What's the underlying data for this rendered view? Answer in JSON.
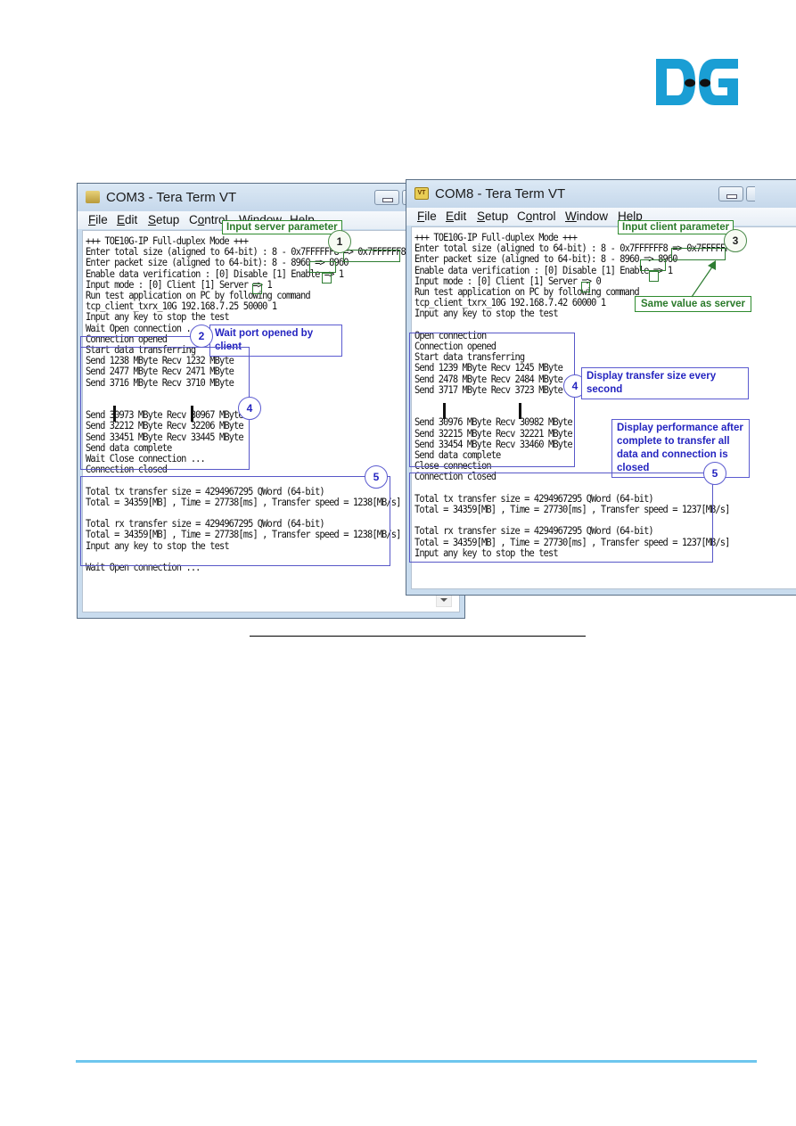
{
  "logo": {
    "text": "DG",
    "brand_color": "#1a9ed4"
  },
  "windows": [
    {
      "title": "COM3 - Tera Term VT",
      "menu": [
        "File",
        "Edit",
        "Setup",
        "Control",
        "Window",
        "Help"
      ],
      "menu_underline": [
        "F",
        "E",
        "S",
        "o",
        "W",
        "H"
      ],
      "lines": [
        "+++ TOE10G-IP Full-duplex Mode +++",
        "Enter total size (aligned to 64-bit) : 8 - 0x7FFFFFF8 => 0x7FFFFFF8",
        "Enter packet size (aligned to 64-bit): 8 - 8960 => 8960",
        "Enable data verification : [0] Disable [1] Enable => 1",
        "Input mode : [0] Client [1] Server => 1",
        "Run test application on PC by following command",
        "tcp_client_txrx_10G 192.168.7.25 50000 1",
        "Input any key to stop the test",
        "Wait Open connection ...",
        "Connection opened",
        "Start data transferring",
        "Send 1238 MByte Recv 1232 MByte",
        "Send 2477 MByte Recv 2471 MByte",
        "Send 3716 MByte Recv 3710 MByte",
        "",
        "",
        "Send 30973 MByte Recv 30967 MByte",
        "Send 32212 MByte Recv 32206 MByte",
        "Send 33451 MByte Recv 33445 MByte",
        "Send data complete",
        "Wait Close connection ...",
        "Connection closed",
        "",
        "Total tx transfer size = 4294967295 QWord (64-bit)",
        "Total = 34359[MB] , Time = 27738[ms] , Transfer speed = 1238[MB/s]",
        "",
        "Total rx transfer size = 4294967295 QWord (64-bit)",
        "Total = 34359[MB] , Time = 27738[ms] , Transfer speed = 1238[MB/s]",
        "Input any key to stop the test",
        "",
        "Wait Open connection ..."
      ],
      "inputs": {
        "total_size": "0x7FFFFFF8",
        "packet_size": "8960",
        "verification": "1",
        "mode": "1"
      }
    },
    {
      "title": "COM8 - Tera Term VT",
      "menu": [
        "File",
        "Edit",
        "Setup",
        "Control",
        "Window",
        "Help"
      ],
      "menu_underline": [
        "F",
        "E",
        "S",
        "o",
        "W",
        "H"
      ],
      "lines": [
        "+++ TOE10G-IP Full-duplex Mode +++",
        "Enter total size (aligned to 64-bit) : 8 - 0x7FFFFFF8 => 0x7FFFFFF8",
        "Enter packet size (aligned to 64-bit): 8 - 8960 => 8960",
        "Enable data verification : [0] Disable [1] Enable => 1",
        "Input mode : [0] Client [1] Server => 0",
        "Run test application on PC by following command",
        "tcp_client_txrx_10G 192.168.7.42 60000 1",
        "Input any key to stop the test",
        "",
        "Open connection",
        "Connection opened",
        "Start data transferring",
        "Send 1239 MByte Recv 1245 MByte",
        "Send 2478 MByte Recv 2484 MByte",
        "Send 3717 MByte Recv 3723 MByte",
        "",
        "",
        "Send 30976 MByte Recv 30982 MByte",
        "Send 32215 MByte Recv 32221 MByte",
        "Send 33454 MByte Recv 33460 MByte",
        "Send data complete",
        "Close connection",
        "Connection closed",
        "",
        "Total tx transfer size = 4294967295 QWord (64-bit)",
        "Total = 34359[MB] , Time = 27730[ms] , Transfer speed = 1237[MB/s]",
        "",
        "Total rx transfer size = 4294967295 QWord (64-bit)",
        "Total = 34359[MB] , Time = 27730[ms] , Transfer speed = 1237[MB/s]",
        "Input any key to stop the test"
      ],
      "inputs": {
        "total_size": "0x7FFFFFF8",
        "packet_size": "8960",
        "verification": "1",
        "mode": "0"
      }
    }
  ],
  "annotations": {
    "server_param": "Input server parameter",
    "client_param": "Input client parameter",
    "wait_port": "Wait port opened by client",
    "same_value": "Same value as server",
    "display_transfer": "Display transfer size every second",
    "display_perf": "Display performance after complete to transfer all data and connection is closed",
    "steps": [
      "1",
      "2",
      "3",
      "4",
      "4",
      "5",
      "5"
    ]
  },
  "colors": {
    "annotation_green": "#2a7a2a",
    "annotation_blue": "#2424c0",
    "footer_line": "#6ec6ee"
  }
}
